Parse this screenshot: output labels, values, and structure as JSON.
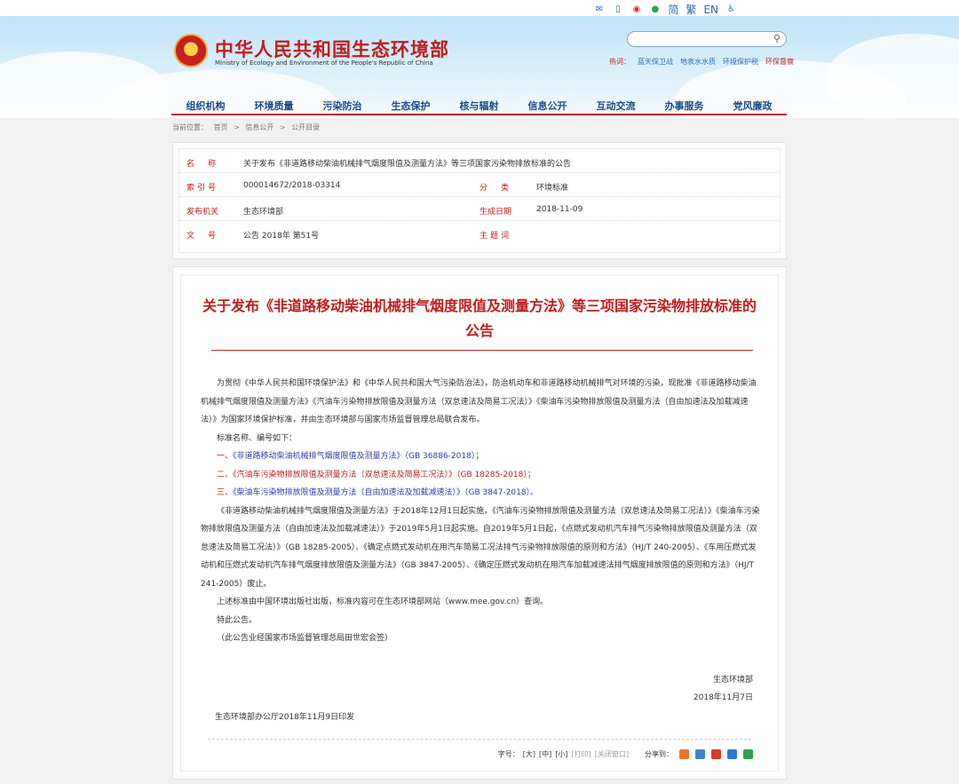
{
  "header": {
    "top_links": {
      "jian": "简",
      "fan": "繁",
      "en": "EN"
    },
    "site_title": "中华人民共和国生态环境部",
    "site_subtitle": "Ministry of Ecology and Environment of the People's Republic of China",
    "search": {
      "placeholder": ""
    },
    "hot_label": "热词：",
    "hot_words": [
      "蓝天保卫战",
      "地表水水质",
      "环境保护税",
      "环保督察"
    ]
  },
  "nav": [
    "组织机构",
    "环境质量",
    "污染防治",
    "生态保护",
    "核与辐射",
    "信息公开",
    "互动交流",
    "办事服务",
    "党风廉政"
  ],
  "breadcrumb": {
    "label": "当前位置：",
    "items": [
      "首页",
      "信息公开",
      "公开目录"
    ],
    "sep": ">"
  },
  "meta": {
    "name_label": "名　称",
    "name_value": "关于发布《非道路移动柴油机械排气烟度限值及测量方法》等三项国家污染物排放标准的公告",
    "index_label": "索引号",
    "index_value": "000014672/2018-03314",
    "category_label": "分　类",
    "category_value": "环境标准",
    "issuer_label": "发布机关",
    "issuer_value": "生态环境部",
    "date_label": "生成日期",
    "date_value": "2018-11-09",
    "docno_label": "文　号",
    "docno_value": "公告 2018年 第51号",
    "topic_label": "主题词",
    "topic_value": ""
  },
  "article": {
    "title": "关于发布《非道路移动柴油机械排气烟度限值及测量方法》等三项国家污染物排放标准的公告",
    "intro": "为贯彻《中华人民共和国环境保护法》和《中华人民共和国大气污染防治法》，防治机动车和非道路移动机械排气对环境的污染，现批准《非道路移动柴油机械排气烟度限值及测量方法》《汽油车污染物排放限值及测量方法（双怠速法及简易工况法）》《柴油车污染物排放限值及测量方法（自由加速法及加载减速法）》为国家环境保护标准，并由生态环境部与国家市场监督管理总局联合发布。",
    "list_label": "标准名称、编号如下：",
    "items": [
      {
        "num": "一、",
        "link": "《非道路移动柴油机械排气烟度限值及测量方法》",
        "code": "（GB 36886-2018）；"
      },
      {
        "num": "二、",
        "link": "《汽油车污染物排放限值及测量方法（双怠速法及简易工况法）》",
        "code": "（GB 18285-2018）；"
      },
      {
        "num": "三、",
        "link": "《柴油车污染物排放限值及测量方法（自由加速法及加载减速法）》",
        "code": "（GB 3847-2018）。"
      }
    ],
    "para2": "《非道路移动柴油机械排气烟度限值及测量方法》于2018年12月1日起实施，《汽油车污染物排放限值及测量方法（双怠速法及简易工况法）》《柴油车污染物排放限值及测量方法（自由加速法及加载减速法）》于2019年5月1日起实施。自2019年5月1日起，《点燃式发动机汽车排气污染物排放限值及测量方法（双怠速法及简易工况法）》（GB 18285-2005）、《确定点燃式发动机在用汽车简易工况法排气污染物排放限值的原则和方法》（HJ/T 240-2005）、《车用压燃式发动机和压燃式发动机汽车排气烟度排放限值及测量方法》（GB 3847-2005）、《确定压燃式发动机在用汽车加载减速法排气烟度排放限值的原则和方法》（HJ/T 241-2005）废止。",
    "para3": "上述标准由中国环境出版社出版，标准内容可在生态环境部网站（www.mee.gov.cn）查询。",
    "para4": "特此公告。",
    "para5": "（此公告业经国家市场监督管理总局田世宏会签）",
    "signer": "生态环境部",
    "sign_date": "2018年11月7日",
    "print_note": "生态环境部办公厅2018年11月9日印发"
  },
  "tools": {
    "font_label": "字号：",
    "large": "[大]",
    "medium": "[中]",
    "small": "[小]",
    "print": "[打印]",
    "close": "[关闭窗口]",
    "share_label": "分享到："
  },
  "colors": {
    "brand_red": "#c01d1d",
    "nav_blue": "#1c4a8c",
    "link_blue": "#2c3cb0"
  }
}
